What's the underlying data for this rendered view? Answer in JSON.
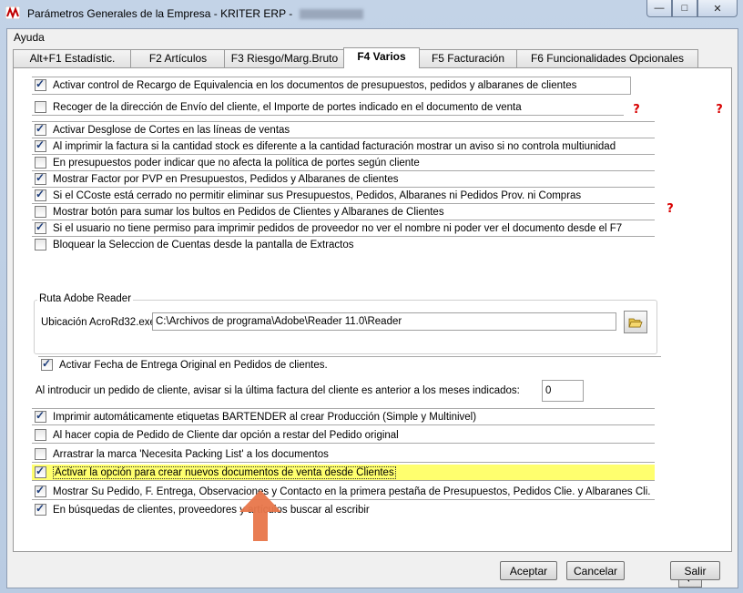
{
  "window": {
    "title": "Parámetros Generales de la Empresa - KRITER ERP - ",
    "controls": {
      "minimize": "—",
      "maximize": "□",
      "close": "✕"
    }
  },
  "menu": {
    "items": [
      "Ayuda"
    ]
  },
  "tabs": [
    {
      "label": "Alt+F1 Estadístic.",
      "active": false
    },
    {
      "label": "F2 Artículos",
      "active": false
    },
    {
      "label": "F3 Riesgo/Marg.Bruto",
      "active": false
    },
    {
      "label": "F4 Varios",
      "active": true
    },
    {
      "label": "F5 Facturación",
      "active": false
    },
    {
      "label": "F6 Funcionalidades Opcionales",
      "active": false
    }
  ],
  "options_top": [
    {
      "label": "Activar control de Recargo de Equivalencia en los documentos de presupuestos, pedidos y albaranes de clientes",
      "checked": true
    },
    {
      "label": "Recoger de la dirección de Envío del cliente, el Importe de portes indicado en el documento de venta",
      "checked": false
    },
    {
      "label": "Activar Desglose de Cortes en las líneas de ventas",
      "checked": true
    },
    {
      "label": "Al imprimir la factura si la cantidad stock es diferente a la cantidad facturación mostrar un aviso si no controla multiunidad",
      "checked": true
    },
    {
      "label": "En presupuestos poder indicar que no afecta la política de portes según cliente",
      "checked": false
    },
    {
      "label": "Mostrar Factor por PVP en Presupuestos, Pedidos y Albaranes de clientes",
      "checked": true
    },
    {
      "label": "Si el CCoste está cerrado no permitir eliminar sus Presupuestos, Pedidos, Albaranes ni Pedidos Prov. ni Compras",
      "checked": true
    },
    {
      "label": "Mostrar botón para sumar los bultos en Pedidos de Clientes y Albaranes de Clientes",
      "checked": false
    },
    {
      "label": "Si el usuario no tiene permiso para imprimir pedidos de proveedor no ver el nombre ni poder ver el documento desde el F7",
      "checked": true
    },
    {
      "label": "Bloquear la Seleccion de Cuentas desde la pantalla de Extractos",
      "checked": false
    }
  ],
  "help_icon": "?",
  "adobe": {
    "group_label": "Ruta Adobe Reader",
    "field_label": "Ubicación AcroRd32.exe",
    "value": "C:\\Archivos de programa\\Adobe\\Reader 11.0\\Reader"
  },
  "fecha_entrega": {
    "label": "Activar Fecha de Entrega Original en Pedidos de clientes.",
    "checked": true
  },
  "meses": {
    "label": "Al introducir un pedido de cliente, avisar si la última factura del cliente es anterior a los meses indicados:",
    "value": "0"
  },
  "options_bottom": [
    {
      "label": "Imprimir automáticamente etiquetas BARTENDER al crear Producción (Simple y Multinivel)",
      "checked": true
    },
    {
      "label": "Al hacer copia de Pedido de Cliente dar opción a restar del Pedido original",
      "checked": false
    },
    {
      "label": "Arrastrar la marca 'Necesita Packing List' a los documentos",
      "checked": false
    },
    {
      "label": "Activar la opción para crear nuevos documentos de venta desde Clientes",
      "checked": true
    },
    {
      "label": "Mostrar Su Pedido, F. Entrega, Observaciones y Contacto en la primera pestaña de Presupuestos, Pedidos Clie. y Albaranes Cli.",
      "checked": true
    },
    {
      "label": "En búsquedas de clientes, proveedores y artículos buscar al escribir",
      "checked": true
    }
  ],
  "buttons": {
    "aceptar": "Aceptar",
    "cancelar": "Cancelar",
    "salir": "Salir"
  },
  "colors": {
    "highlight": "#ffff6e",
    "arrow": "#e8764a",
    "help": "#d80000"
  }
}
